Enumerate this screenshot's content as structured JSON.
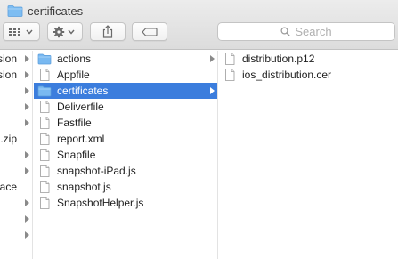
{
  "window": {
    "title": "certificates"
  },
  "toolbar": {
    "view_icon": "grid-view-icon",
    "action_icon": "gear-icon",
    "share_icon": "share-icon",
    "tag_icon": "tag-icon"
  },
  "search": {
    "placeholder": "Search"
  },
  "column1": {
    "items": [
      {
        "label": "sion",
        "arrow": true
      },
      {
        "label": "sion",
        "arrow": true
      },
      {
        "label": "",
        "arrow": true
      },
      {
        "label": "",
        "arrow": true
      },
      {
        "label": "",
        "arrow": true
      },
      {
        "label": ".zip",
        "arrow": false
      },
      {
        "label": "",
        "arrow": true
      },
      {
        "label": "",
        "arrow": true
      },
      {
        "label": "ace",
        "arrow": false
      },
      {
        "label": "",
        "arrow": true
      },
      {
        "label": "",
        "arrow": true
      },
      {
        "label": "",
        "arrow": true
      }
    ]
  },
  "column2": {
    "items": [
      {
        "label": "actions",
        "type": "folder",
        "arrow": true,
        "selected": false
      },
      {
        "label": "Appfile",
        "type": "file",
        "arrow": false,
        "selected": false
      },
      {
        "label": "certificates",
        "type": "folder",
        "arrow": true,
        "selected": true
      },
      {
        "label": "Deliverfile",
        "type": "file",
        "arrow": false,
        "selected": false
      },
      {
        "label": "Fastfile",
        "type": "file",
        "arrow": false,
        "selected": false
      },
      {
        "label": "report.xml",
        "type": "file",
        "arrow": false,
        "selected": false
      },
      {
        "label": "Snapfile",
        "type": "file",
        "arrow": false,
        "selected": false
      },
      {
        "label": "snapshot-iPad.js",
        "type": "file",
        "arrow": false,
        "selected": false
      },
      {
        "label": "snapshot.js",
        "type": "file",
        "arrow": false,
        "selected": false
      },
      {
        "label": "SnapshotHelper.js",
        "type": "file",
        "arrow": false,
        "selected": false
      }
    ]
  },
  "column3": {
    "items": [
      {
        "label": "distribution.p12",
        "type": "file"
      },
      {
        "label": "ios_distribution.cer",
        "type": "file"
      }
    ]
  },
  "colors": {
    "selection": "#3b7ddd",
    "folder": "#6fb3ef"
  }
}
